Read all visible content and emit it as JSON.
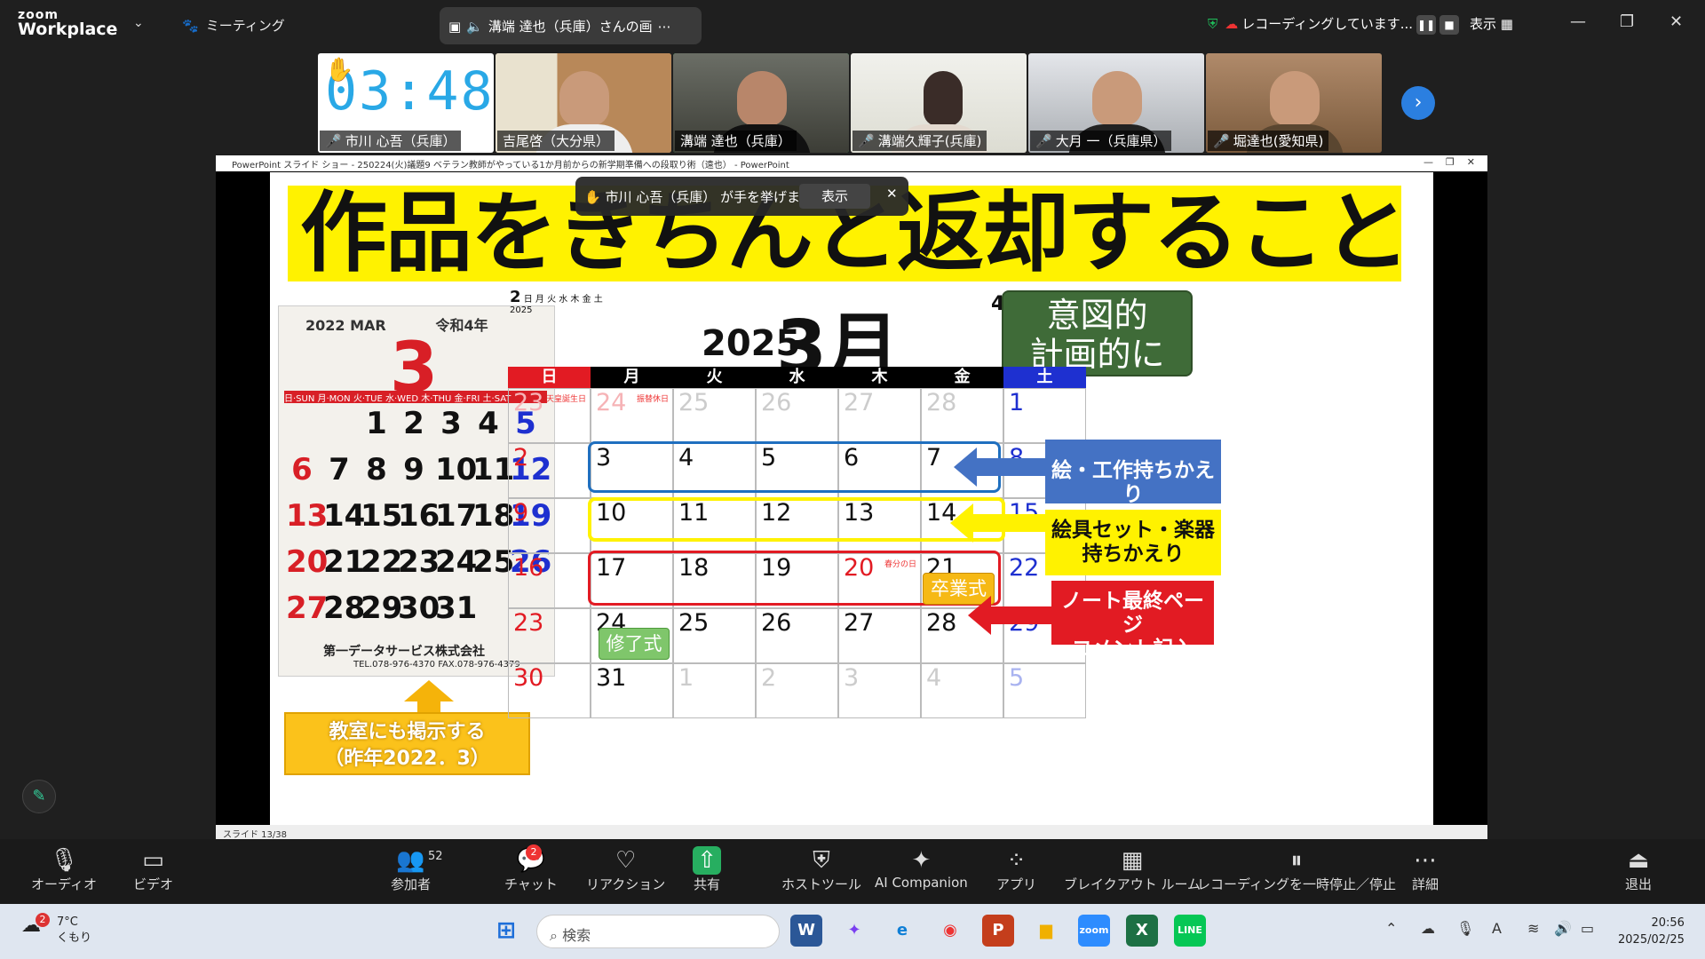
{
  "app": {
    "brand_top": "zoom",
    "brand_bottom": "Workplace",
    "meeting_menu": "ミーティング",
    "speaker": "溝端 達也（兵庫）さんの画",
    "recording": "レコーディングしています...",
    "view": "表示"
  },
  "participants": [
    {
      "name": "市川 心吾（兵庫）",
      "timer": "03:48"
    },
    {
      "name": "吉尾啓（大分県）"
    },
    {
      "name": "溝端 達也（兵庫）"
    },
    {
      "name": "溝端久輝子(兵庫)"
    },
    {
      "name": "大月 一（兵庫県）"
    },
    {
      "name": "堀達也(愛知県)"
    }
  ],
  "ppt": {
    "window_title": "PowerPoint スライド ショー - 250224(火)議題9 ベテラン教師がやっている1か月前からの新学期準備への段取り術（遠也） - PowerPoint",
    "status": "スライド 13/38"
  },
  "hand_notice": {
    "text": "市川 心吾（兵庫） が手を挙げました",
    "button": "表示"
  },
  "slide": {
    "title": "作品をきちんと返却すること",
    "photo": {
      "header": "2022 MAR",
      "era": "令和4年",
      "month": "3",
      "weekdays": "日·SUN 月·MON 火·TUE 水·WED 木·THU 金·FRI 土·SAT",
      "company": "第一データサービス株式会社",
      "tel": "TEL.078-976-4370 FAX.078-976-4379",
      "days": [
        "1",
        "2",
        "3",
        "4",
        "5",
        "6",
        "7",
        "8",
        "9",
        "10",
        "11",
        "12",
        "13",
        "14",
        "15",
        "16",
        "17",
        "18",
        "19",
        "20",
        "21",
        "22",
        "23",
        "24",
        "25",
        "26",
        "27",
        "28",
        "29",
        "30",
        "31"
      ]
    },
    "note_classroom_line1": "教室にも掲示する",
    "note_classroom_line2": "（昨年2022．3）",
    "mini_feb": {
      "label": "2",
      "year": "2025",
      "header": "日 月 火 水 木 金 土"
    },
    "calendar_year": "2025",
    "calendar_month": "3月",
    "next_month": "4",
    "green_box_line1": "意図的",
    "green_box_line2": "計画的に",
    "weekdays": [
      "日",
      "月",
      "火",
      "水",
      "木",
      "金",
      "土"
    ],
    "rows": [
      [
        "23",
        "24",
        "25",
        "26",
        "27",
        "28",
        "1"
      ],
      [
        "2",
        "3",
        "4",
        "5",
        "6",
        "7",
        "8"
      ],
      [
        "9",
        "10",
        "11",
        "12",
        "13",
        "14",
        "15"
      ],
      [
        "16",
        "17",
        "18",
        "19",
        "20",
        "21",
        "22"
      ],
      [
        "23",
        "24",
        "25",
        "26",
        "27",
        "28",
        "29"
      ],
      [
        "30",
        "31",
        "1",
        "2",
        "3",
        "4",
        "5"
      ]
    ],
    "holiday_notes": {
      "feb23": "天皇誕生日",
      "feb24": "振替休日",
      "mar20": "春分の日"
    },
    "graduation": "卒業式",
    "closing": "修了式",
    "label_art_line1": "絵・工作持ちかえり",
    "label_paint_line1": "絵具セット・楽器",
    "label_paint_line2": "持ちかえり",
    "label_note_line1": "ノート最終ページ",
    "label_note_line2": "コメント記入"
  },
  "toolbar": [
    {
      "label": "オーディオ",
      "icon": "mic-icon"
    },
    {
      "label": "ビデオ",
      "icon": "camera-icon"
    },
    {
      "label": "参加者",
      "icon": "participants-icon",
      "count": "52"
    },
    {
      "label": "チャット",
      "icon": "chat-icon",
      "badge": "2"
    },
    {
      "label": "リアクション",
      "icon": "heart-icon"
    },
    {
      "label": "共有",
      "icon": "share-icon"
    },
    {
      "label": "ホストツール",
      "icon": "shield-icon"
    },
    {
      "label": "AI Companion",
      "icon": "sparkle-icon"
    },
    {
      "label": "アプリ",
      "icon": "apps-icon"
    },
    {
      "label": "ブレイクアウト ルーム",
      "icon": "grid-icon"
    },
    {
      "label": "レコーディングを一時停止／停止",
      "icon": "record-pause-icon"
    },
    {
      "label": "詳細",
      "icon": "more-icon"
    },
    {
      "label": "退出",
      "icon": "leave-icon"
    }
  ],
  "taskbar": {
    "weather_temp": "7°C",
    "weather_desc": "くもり",
    "weather_badge": "2",
    "search": "検索",
    "time": "20:56",
    "date": "2025/02/25"
  }
}
